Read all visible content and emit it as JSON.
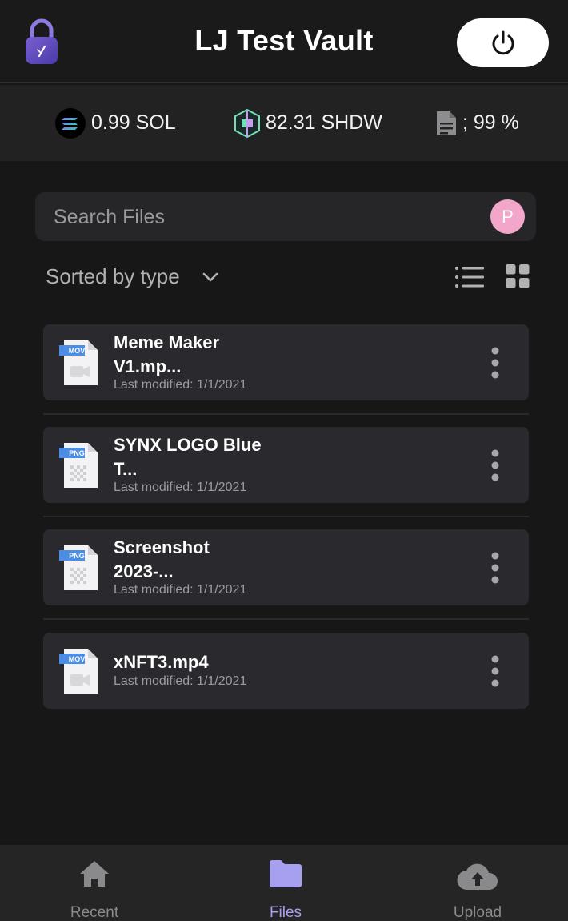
{
  "header": {
    "title": "LJ Test Vault",
    "lock_icon": "lock-icon",
    "power_icon": "power-icon"
  },
  "stats": {
    "sol": {
      "value": "0.99 SOL",
      "icon": "solana-icon"
    },
    "shdw": {
      "value": "82.31 SHDW",
      "icon": "shdw-icon"
    },
    "storage": {
      "value": "; 99 %",
      "icon": "document-icon"
    }
  },
  "search": {
    "placeholder": "Search Files",
    "avatar_initial": "P"
  },
  "sort": {
    "label": "Sorted by type",
    "icon": "chevron-down-icon"
  },
  "files": [
    {
      "type_badge": "MOV",
      "name_line1": "Meme Maker",
      "name_line2": "V1.mp...",
      "modified": "Last modified: 1/1/2021"
    },
    {
      "type_badge": "PNG",
      "name_line1": "SYNX LOGO Blue",
      "name_line2": "T...",
      "modified": "Last modified: 1/1/2021"
    },
    {
      "type_badge": "PNG",
      "name_line1": "Screenshot",
      "name_line2": "2023-...",
      "modified": "Last modified: 1/1/2021"
    },
    {
      "type_badge": "MOV",
      "name_line1": "xNFT3.mp4",
      "name_line2": "",
      "modified": "Last modified: 1/1/2021"
    }
  ],
  "nav": {
    "recent": "Recent",
    "files": "Files",
    "upload": "Upload",
    "active": "Files"
  },
  "colors": {
    "accent": "#a79ff0",
    "background": "#171718",
    "card": "#2a2a2e"
  }
}
